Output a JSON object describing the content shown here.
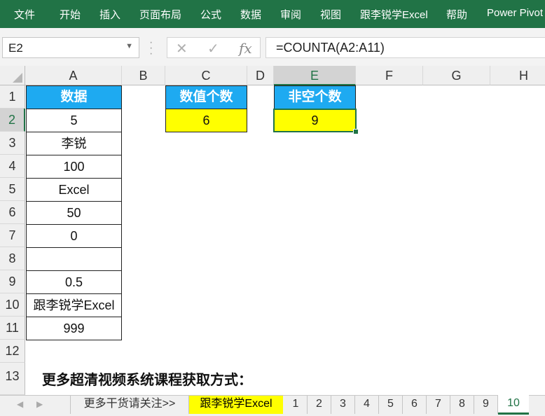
{
  "ribbon": {
    "tabs": [
      "文件",
      "开始",
      "插入",
      "页面布局",
      "公式",
      "数据",
      "审阅",
      "视图",
      "跟李锐学Excel",
      "帮助",
      "Power Pivot"
    ]
  },
  "formula_bar": {
    "name_box": "E2",
    "cancel_icon": "✕",
    "enter_icon": "✓",
    "fx_label": "fx",
    "formula": "=COUNTA(A2:A11)"
  },
  "grid": {
    "columns": [
      "A",
      "B",
      "C",
      "D",
      "E",
      "F",
      "G",
      "H"
    ],
    "rows": [
      "1",
      "2",
      "3",
      "4",
      "5",
      "6",
      "7",
      "8",
      "9",
      "10",
      "11",
      "12",
      "13"
    ],
    "a_column": {
      "header": "数据",
      "values": [
        "5",
        "李锐",
        "100",
        "Excel",
        "50",
        "0",
        "",
        "0.5",
        "跟李锐学Excel",
        "999"
      ]
    },
    "c_header": "数值个数",
    "c_value": "6",
    "e_header": "非空个数",
    "e_value": "9",
    "footer_text": "更多超清视频系统课程获取方式："
  },
  "sheet_tabs": [
    "更多干货请关注>>",
    "跟李锐学Excel",
    "1",
    "2",
    "3",
    "4",
    "5",
    "6",
    "7",
    "8",
    "9",
    "10"
  ],
  "active_sheet": "10",
  "colors": {
    "ribbon": "#217346",
    "header_fill": "#1eaaf1",
    "highlight": "#ffff00"
  }
}
